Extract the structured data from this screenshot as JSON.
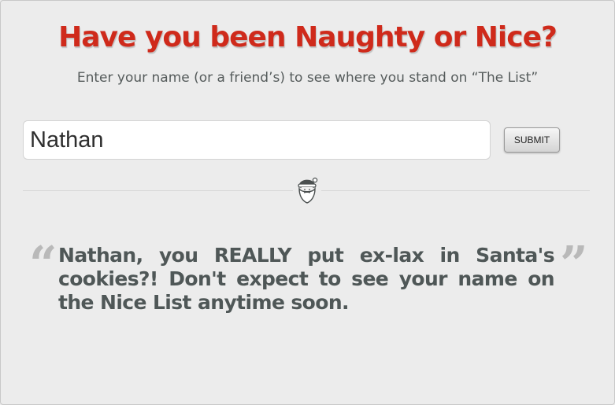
{
  "header": {
    "title": "Have you been Naughty or Nice?",
    "subtitle": "Enter your name (or a friend’s) to see where you stand on “The List”"
  },
  "form": {
    "name_value": "Nathan",
    "submit_label": "SUBMIT"
  },
  "divider": {
    "icon": "santa-icon"
  },
  "result": {
    "open_quote": "“",
    "close_quote": "”",
    "message": "Nathan, you REALLY put ex-lax in Santa's cookies?! Don't expect to see your name on the Nice List anytime soon."
  },
  "colors": {
    "title": "#cf2a1b",
    "body_text": "#4f5757",
    "background": "#ececec"
  }
}
